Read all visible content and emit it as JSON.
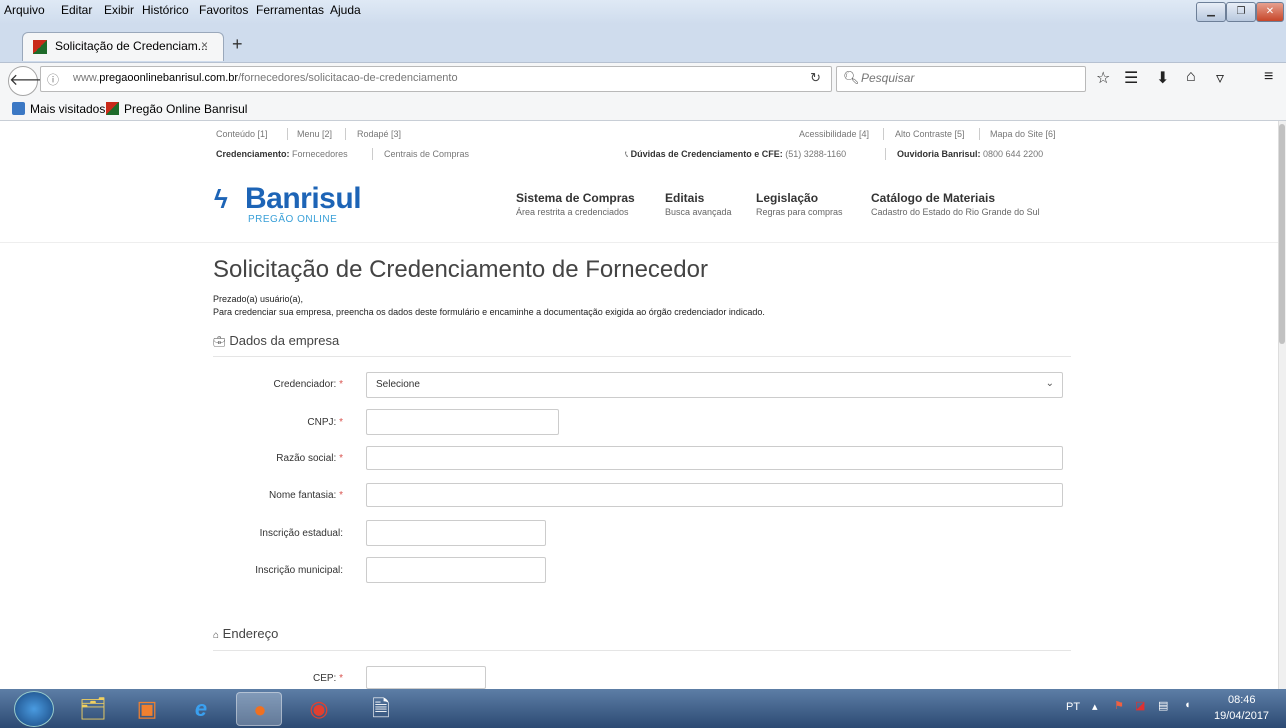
{
  "menubar": {
    "items": [
      "Arquivo",
      "Editar",
      "Exibir",
      "Histórico",
      "Favoritos",
      "Ferramentas",
      "Ajuda"
    ]
  },
  "tab": {
    "title": "Solicitação de Credenciam...",
    "close": "×",
    "new_tab": "+"
  },
  "navbar": {
    "url_plain_prefix": "www.",
    "url_domain": "pregaoonlinebanrisul.com.br",
    "url_path": "/fornecedores/solicitacao-de-credenciamento",
    "search_placeholder": "Pesquisar"
  },
  "bookmarks": {
    "most_visited": "Mais visitados",
    "pregao": "Pregão Online Banrisul"
  },
  "header": {
    "skip_links": [
      "Conteúdo [1]",
      "Menu [2]",
      "Rodapé [3]"
    ],
    "access_links": [
      "Acessibilidade [4]",
      "Alto Contraste [5]",
      "Mapa do Site [6]"
    ],
    "cred_label": "Credenciamento:",
    "cred_links": [
      "Fornecedores",
      "Centrais de Compras"
    ],
    "duvidas_label": "Dúvidas de Credenciamento e CFE:",
    "duvidas_phone": "(51) 3288-1160",
    "ouvidoria_label": "Ouvidoria Banrisul:",
    "ouvidoria_phone": "0800 644 2200",
    "logo_name": "Banrisul",
    "logo_sub": "PREGÃO ONLINE",
    "nav": [
      {
        "title": "Sistema de Compras",
        "sub": "Área restrita a credenciados"
      },
      {
        "title": "Editais",
        "sub": "Busca avançada"
      },
      {
        "title": "Legislação",
        "sub": "Regras para compras"
      },
      {
        "title": "Catálogo de Materiais",
        "sub": "Cadastro do Estado do Rio Grande do Sul"
      }
    ]
  },
  "main": {
    "title": "Solicitação de Credenciamento de Fornecedor",
    "intro_1": "Prezado(a) usuário(a),",
    "intro_2": "Para credenciar sua empresa, preencha os dados deste formulário e encaminhe a documentação exigida ao órgão credenciador indicado.",
    "section_empresa": "Dados da empresa",
    "section_endereco": "Endereço",
    "fields": {
      "credenciador": "Credenciador:",
      "credenciador_value": "Selecione",
      "cnpj": "CNPJ:",
      "razao": "Razão social:",
      "fantasia": "Nome fantasia:",
      "estadual": "Inscrição estadual:",
      "municipal": "Inscrição municipal:",
      "cep": "CEP:"
    },
    "required_mark": "*"
  },
  "taskbar": {
    "lang": "PT",
    "time": "08:46",
    "date": "19/04/2017"
  },
  "colors": {
    "brand": "#1d64b6",
    "brand_light": "#39a0d8",
    "required": "#d9534f"
  }
}
